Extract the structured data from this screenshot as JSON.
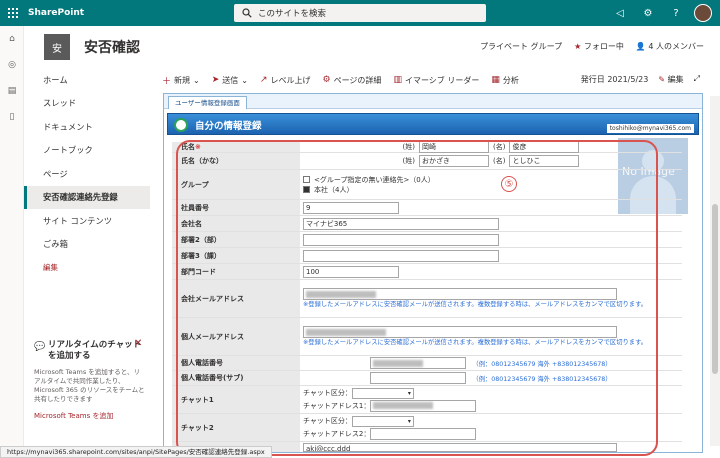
{
  "app": {
    "name": "SharePoint",
    "search_placeholder": "このサイトを検索"
  },
  "site": {
    "logo_text": "安",
    "title": "安否確認",
    "group": "プライベート グループ",
    "follow": "フォロー中",
    "members": "4 人のメンバー"
  },
  "nav": [
    {
      "label": "ホーム"
    },
    {
      "label": "スレッド"
    },
    {
      "label": "ドキュメント"
    },
    {
      "label": "ノートブック"
    },
    {
      "label": "ページ"
    },
    {
      "label": "安否確認連絡先登録",
      "active": true
    },
    {
      "label": "サイト コンテンツ"
    },
    {
      "label": "ごみ箱"
    },
    {
      "label": "編集",
      "edit": true
    }
  ],
  "promo": {
    "title": "リアルタイムのチャットを追加する",
    "text": "Microsoft Teams を追加すると、リアルタイムで共同作業したり、Microsoft 365 のリソースをチームと共有したりできます",
    "link": "Microsoft Teams を追加"
  },
  "cmd": {
    "new": "新規",
    "send": "送信",
    "levelup": "レベル上げ",
    "details": "ページの詳細",
    "immersive": "イマーシブ リーダー",
    "analytics": "分析",
    "published": "発行日 2021/5/23",
    "edit": "編集"
  },
  "form": {
    "tab": "ユーザー情報登録画面",
    "title": "自分の情報登録",
    "user": "toshihiko@mynavi365.com",
    "noimage": "No Image",
    "annotation": "⑤",
    "labels": {
      "name": "氏名",
      "kana": "氏名（かな）",
      "group": "グループ",
      "empno": "社員番号",
      "company": "会社名",
      "dept2": "部署2（部）",
      "dept3": "部署3（課）",
      "deptcode": "部門コード",
      "cmail": "会社メールアドレス",
      "pmail": "個人メールアドレス",
      "phone": "個人電話番号",
      "phone2": "個人電話番号(サブ)",
      "chat1": "チャット1",
      "chat2": "チャット2"
    },
    "required": "※",
    "sei": "(姓)",
    "mei": "(名)",
    "name_sei": "岡崎",
    "name_mei": "俊彦",
    "kana_sei": "おかざき",
    "kana_mei": "としひこ",
    "group1": "<グループ指定の無い連絡先>（0人）",
    "group2": "本社（4人）",
    "empno_val": "9",
    "company_val": "マイナビ365",
    "deptcode_val": "100",
    "mail_note": "※登録したメールアドレスに安否確認メールが送信されます。複数登録する時は、メールアドレスをカンマで区切ります。",
    "phone_ex": "（例：08012345679 海外 +838012345678）",
    "chat_kind": "チャット区分：",
    "chat_addr1": "チャットアドレス1：",
    "chat_addr2": "チャットアドレス2：",
    "last_val": "aki@ccc.ddd"
  },
  "status_url": "https://mynavi365.sharepoint.com/sites/anpi/SitePages/安否確認連絡先登録.aspx"
}
